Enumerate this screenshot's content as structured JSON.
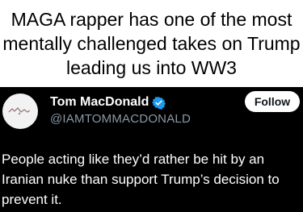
{
  "caption": {
    "text": "MAGA rapper has one of the most mentally challenged takes on Trump leading us into WW3"
  },
  "tweet": {
    "author": {
      "display_name": "Tom MacDonald",
      "handle": "@IAMTOMMACDONALD",
      "verified": true,
      "verified_icon": "verified-badge-icon",
      "avatar_icon": "avatar-image"
    },
    "follow_label": "Follow",
    "text": "People acting like they’d rather be hit by an Iranian nuke than support Trump’s decision to prevent it."
  },
  "colors": {
    "tweet_background": "#000000",
    "tweet_text": "#ffffff",
    "handle_text": "#8b98a5",
    "verified_badge": "#1d9bf0",
    "follow_button_bg": "#ffffff",
    "follow_button_text": "#0f1419",
    "caption_background": "#ffffff",
    "caption_text": "#000000"
  }
}
